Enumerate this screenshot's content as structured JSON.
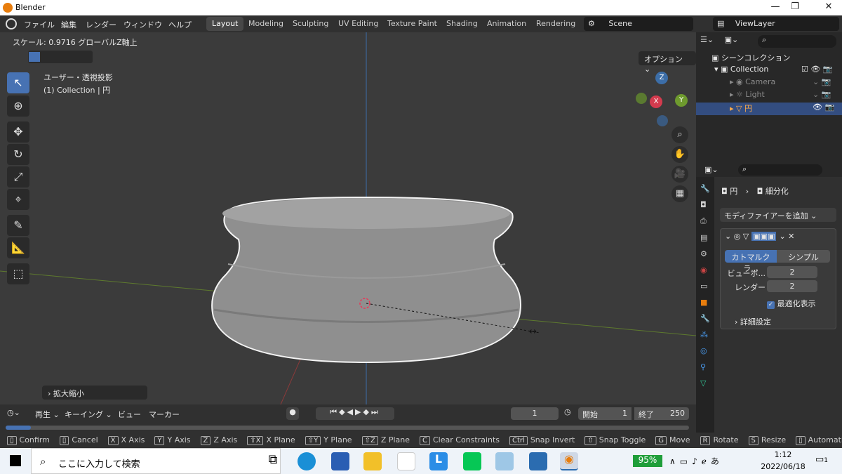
{
  "window": {
    "title": "Blender"
  },
  "topbar": {
    "menus": [
      "ファイル",
      "編集",
      "レンダー",
      "ウィンドウ",
      "ヘルプ"
    ],
    "tabs": [
      "Layout",
      "Modeling",
      "Sculpting",
      "UV Editing",
      "Texture Paint",
      "Shading",
      "Animation",
      "Rendering"
    ],
    "scene": "Scene",
    "view_layer": "ViewLayer"
  },
  "viewport": {
    "operator_info": "スケール: 0.9716 グローバルZ軸上",
    "view_name": "ユーザー・透視投影",
    "collection_info": "(1) Collection | 円",
    "options_label": "オプション",
    "redo_panel": "拡大縮小",
    "gizmo": {
      "z": "Z",
      "y": "Y",
      "x": "X"
    }
  },
  "outliner": {
    "scene_collection": "シーンコレクション",
    "items": [
      "Collection",
      "Camera",
      "Light",
      "円"
    ]
  },
  "properties": {
    "object": "円",
    "modifier": "細分化",
    "add_modifier": "モディファイアーを追加",
    "mode_catmull": "カトマルクラ...",
    "mode_simple": "シンプル",
    "viewport_label": "ビューポ...",
    "viewport_value": "2",
    "render_label": "レンダー",
    "render_value": "2",
    "optimal_label": "最適化表示",
    "advanced_label": "詳細設定"
  },
  "timeline": {
    "playback": "再生",
    "keying": "キーイング",
    "view": "ビュー",
    "marker": "マーカー",
    "current_frame": "1",
    "start_label": "開始",
    "start": "1",
    "end_label": "終了",
    "end": "250"
  },
  "statusbar": {
    "items": [
      {
        "key": "",
        "label": "Confirm"
      },
      {
        "key": "",
        "label": "Cancel"
      },
      {
        "key": "X",
        "label": "X Axis"
      },
      {
        "key": "Y",
        "label": "Y Axis"
      },
      {
        "key": "Z",
        "label": "Z Axis"
      },
      {
        "key": "⇧X",
        "label": "X Plane"
      },
      {
        "key": "⇧Y",
        "label": "Y Plane"
      },
      {
        "key": "⇧Z",
        "label": "Z Plane"
      },
      {
        "key": "C",
        "label": "Clear Constraints"
      },
      {
        "key": "Ctrl",
        "label": "Snap Invert"
      },
      {
        "key": "⇧",
        "label": "Snap Toggle"
      },
      {
        "key": "G",
        "label": "Move"
      },
      {
        "key": "R",
        "label": "Rotate"
      },
      {
        "key": "S",
        "label": "Resize"
      },
      {
        "key": "",
        "label": "Automatic C"
      }
    ]
  },
  "taskbar": {
    "search_placeholder": "ここに入力して検索",
    "battery": "95%",
    "time": "1:12",
    "date": "2022/06/18",
    "notif_count": "1"
  }
}
